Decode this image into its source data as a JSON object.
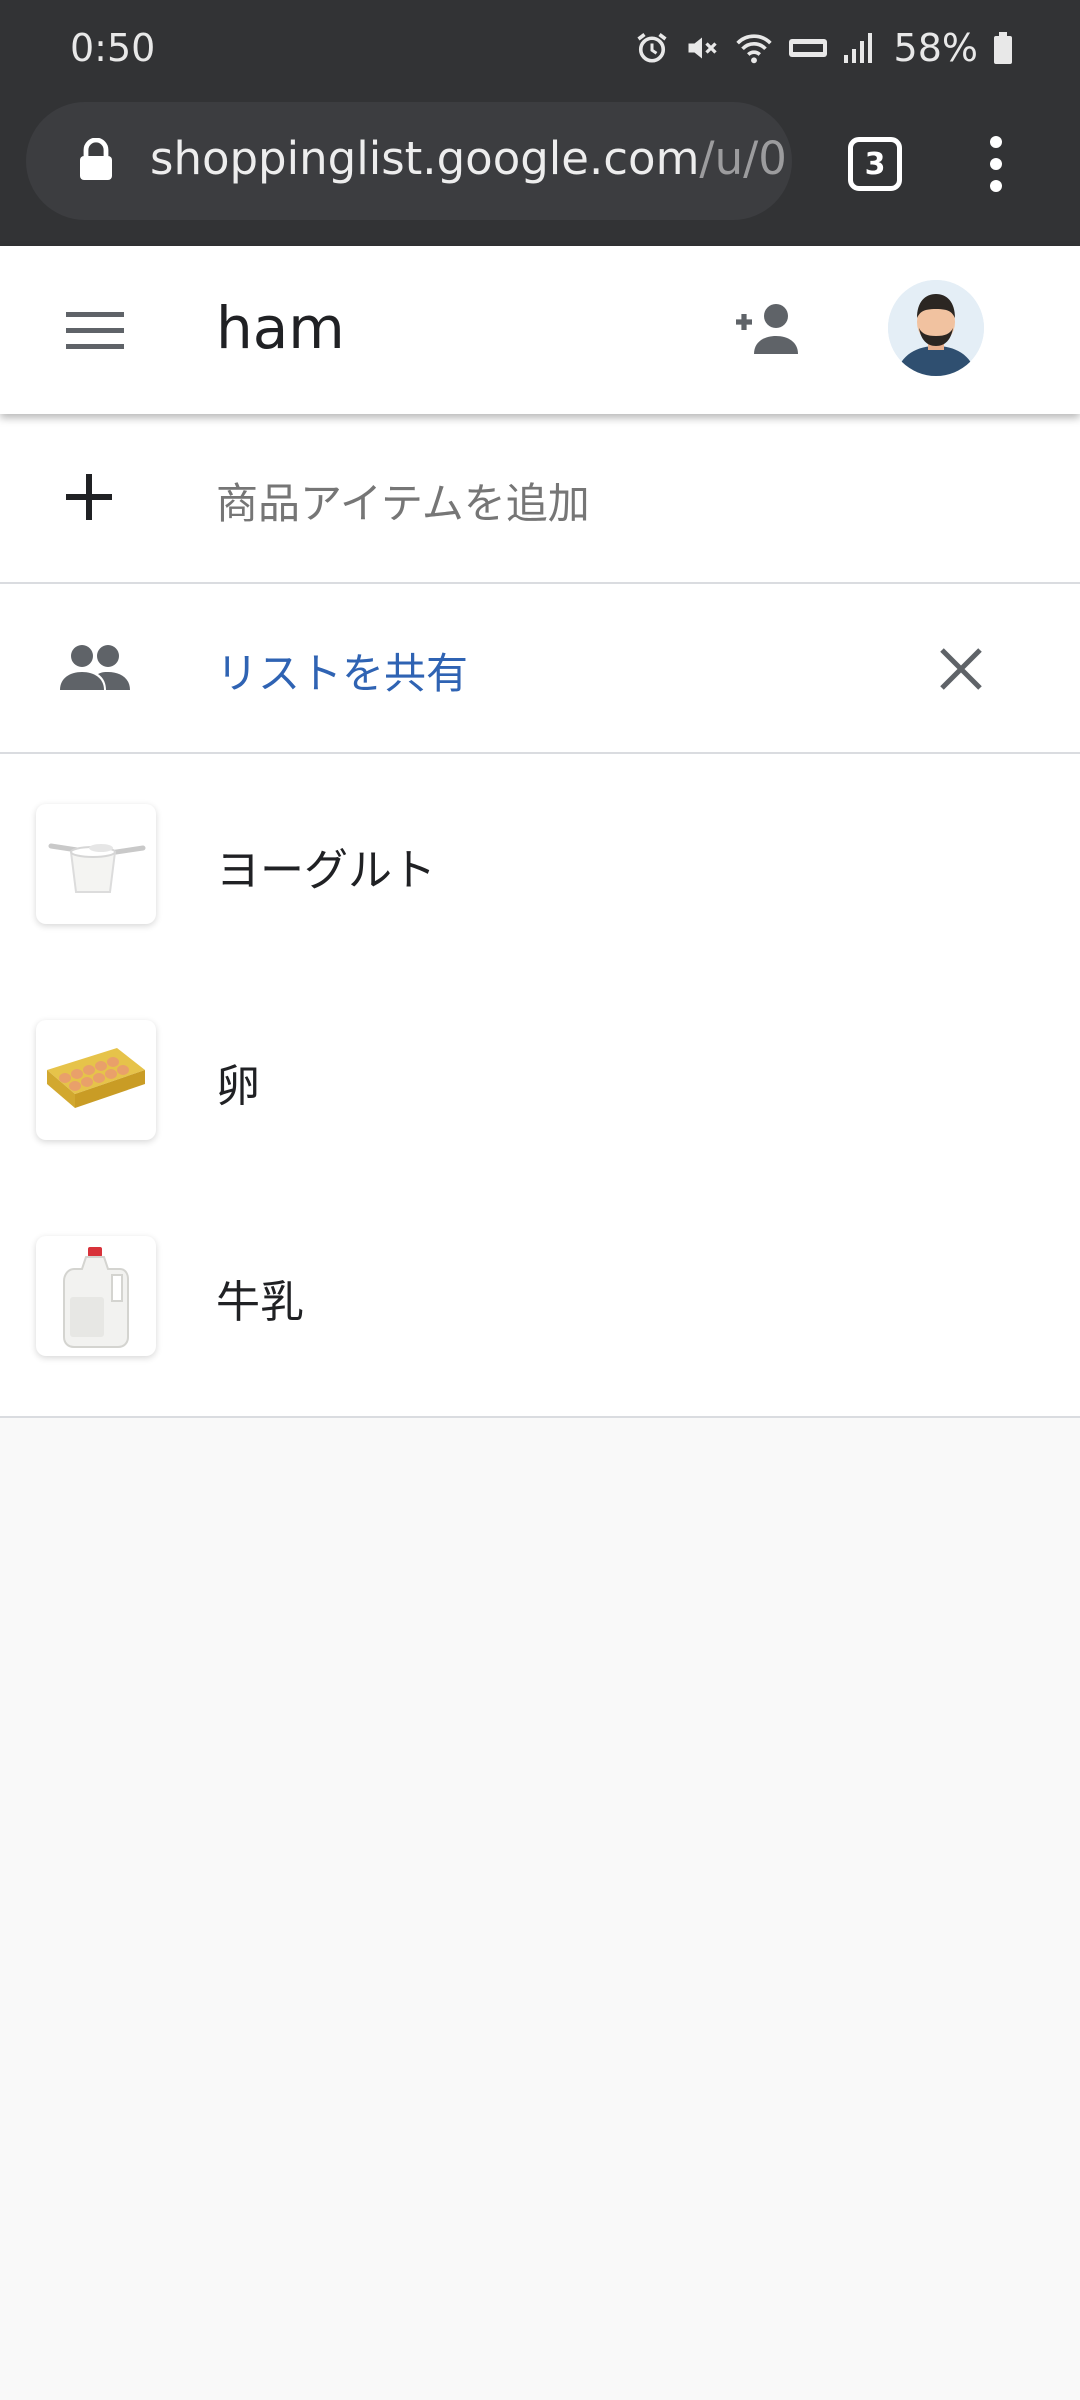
{
  "status_bar": {
    "time": "0:50",
    "battery": "58%",
    "icons": [
      "alarm-icon",
      "mute-icon",
      "wifi-icon",
      "volte-icon",
      "signal-icon",
      "battery-icon"
    ]
  },
  "browser": {
    "url_host": "shoppinglist.google.com",
    "url_path": "/u/0",
    "tab_count": "3",
    "icons": [
      "lock-icon",
      "overflow-menu-icon"
    ]
  },
  "header": {
    "title": "ham",
    "icons": [
      "menu-icon",
      "add-person-icon",
      "avatar"
    ]
  },
  "add_item": {
    "placeholder": "商品アイテムを追加",
    "icon": "plus-icon"
  },
  "share": {
    "label": "リストを共有",
    "icons": [
      "people-icon",
      "close-icon"
    ],
    "link_color": "#2f63b3"
  },
  "items": [
    {
      "name": "ヨーグルト",
      "image": "yogurt"
    },
    {
      "name": "卵",
      "image": "eggs"
    },
    {
      "name": "牛乳",
      "image": "milk"
    }
  ]
}
